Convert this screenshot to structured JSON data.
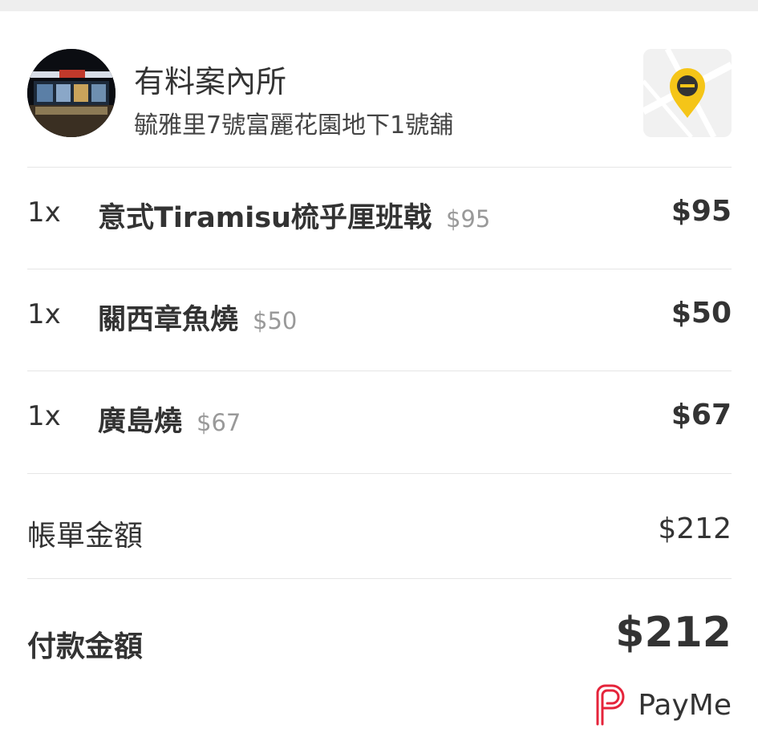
{
  "merchant": {
    "name": "有料案內所",
    "address": "毓雅里7號富麗花園地下1號舖",
    "avatar_sign_text": "有料案內所"
  },
  "order": {
    "items": [
      {
        "qty": "1x",
        "name": "意式Tiramisu梳乎厘班戟",
        "unit_price": "$95",
        "total": "$95"
      },
      {
        "qty": "1x",
        "name": "關西章魚燒",
        "unit_price": "$50",
        "total": "$50"
      },
      {
        "qty": "1x",
        "name": "廣島燒",
        "unit_price": "$67",
        "total": "$67"
      }
    ]
  },
  "summary": {
    "bill_label": "帳單金額",
    "bill_value": "$212",
    "pay_label": "付款金額",
    "pay_value": "$212"
  },
  "payment": {
    "method": "PayMe",
    "brand_color": "#e5243b"
  },
  "icons": {
    "map": "map-pin-icon",
    "payme": "payme-logo-icon"
  },
  "colors": {
    "text": "#333333",
    "muted": "#999999",
    "map_pin": "#f5c518",
    "divider": "#e6e6e6"
  }
}
